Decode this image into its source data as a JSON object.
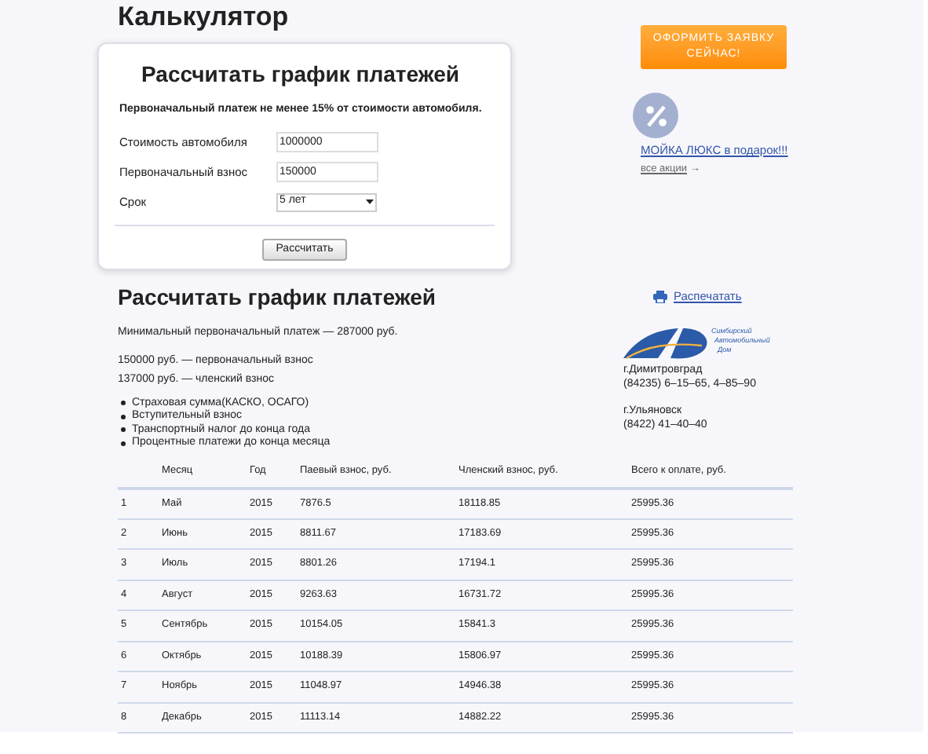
{
  "page_title": "Калькулятор",
  "calculator": {
    "title": "Рассчитать график платежей",
    "note": "Первоначальный платеж не менее 15% от стоимости автомобиля.",
    "fields": [
      {
        "kind": "input",
        "label": "Стоимость автомобиля",
        "value": "1000000"
      },
      {
        "kind": "input",
        "label": "Первоначальный взнос",
        "value": "150000"
      },
      {
        "kind": "select",
        "label": "Срок",
        "value": "5 лет"
      }
    ],
    "button": "Рассчитать"
  },
  "sidebar": {
    "cta_button": "ОФОРМИТЬ ЗАЯВКУ СЕЙЧАС!",
    "promo_link": "МОЙКА ЛЮКС в подарок!!!",
    "all_promos_link": "все акции",
    "all_promos_arrow": "→"
  },
  "results": {
    "title": "Рассчитать график платежей",
    "print_link": "Распечатать",
    "min_payment": "Минимальный первоначальный платеж — 287000 руб.",
    "lines": [
      "150000 руб. — первоначальный взнос",
      "137000 руб. — членский взнос"
    ],
    "bullets": [
      "Страховая сумма(КАСКО, ОСАГО)",
      "Вступительный взнос",
      "Транспортный налог до конца года",
      "Процентные платежи до конца месяца"
    ],
    "logo_text": [
      "Симбирский",
      "Автомобильный",
      "Дом"
    ],
    "contacts": [
      {
        "city": "г.Димитровград",
        "phone": "(84235) 6–15–65, 4–85–90"
      },
      {
        "city": "г.Ульяновск",
        "phone": "(8422) 41–40–40"
      }
    ]
  },
  "table": {
    "columns": [
      "",
      "Месяц",
      "Год",
      "Паевый взнос, руб.",
      "Членский взнос, руб.",
      "Всего к оплате, руб."
    ],
    "rows": [
      [
        "1",
        "Май",
        "2015",
        "7876.5",
        "18118.85",
        "25995.36"
      ],
      [
        "2",
        "Июнь",
        "2015",
        "8811.67",
        "17183.69",
        "25995.36"
      ],
      [
        "3",
        "Июль",
        "2015",
        "8801.26",
        "17194.1",
        "25995.36"
      ],
      [
        "4",
        "Август",
        "2015",
        "9263.63",
        "16731.72",
        "25995.36"
      ],
      [
        "5",
        "Сентябрь",
        "2015",
        "10154.05",
        "15841.3",
        "25995.36"
      ],
      [
        "6",
        "Октябрь",
        "2015",
        "10188.39",
        "15806.97",
        "25995.36"
      ],
      [
        "7",
        "Ноябрь",
        "2015",
        "11048.97",
        "14946.38",
        "25995.36"
      ],
      [
        "8",
        "Декабрь",
        "2015",
        "11113.14",
        "14882.22",
        "25995.36"
      ]
    ]
  }
}
